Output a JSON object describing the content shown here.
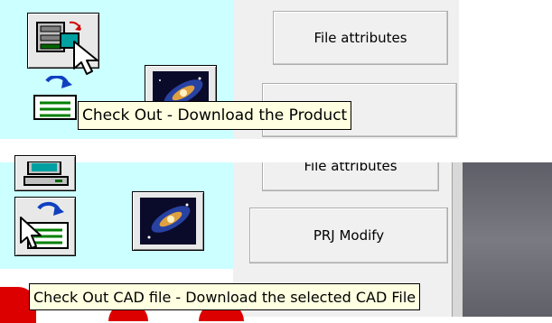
{
  "top_panel": {
    "file_attributes_label": "File attributes",
    "tooltip_text": "Check Out - Download the Product"
  },
  "bottom_panel": {
    "file_attributes_label": "File attributes",
    "prj_modify_label": "PRJ Modify",
    "tooltip_text": "Check Out CAD file - Download the selected CAD File"
  },
  "icons": {
    "checkout_product": "checkout-product-icon",
    "checkout_cad": "checkout-cad-icon",
    "galaxy_image": "galaxy-image-icon",
    "computer": "computer-icon",
    "mouse_cursor": "mouse-cursor-icon"
  },
  "colors": {
    "panel_cyan": "#ccffff",
    "panel_gray": "#f0f0f0",
    "tooltip_bg": "#ffffe1",
    "dark_gray_area": "#6e6e76",
    "red_accent": "#dd0000"
  }
}
